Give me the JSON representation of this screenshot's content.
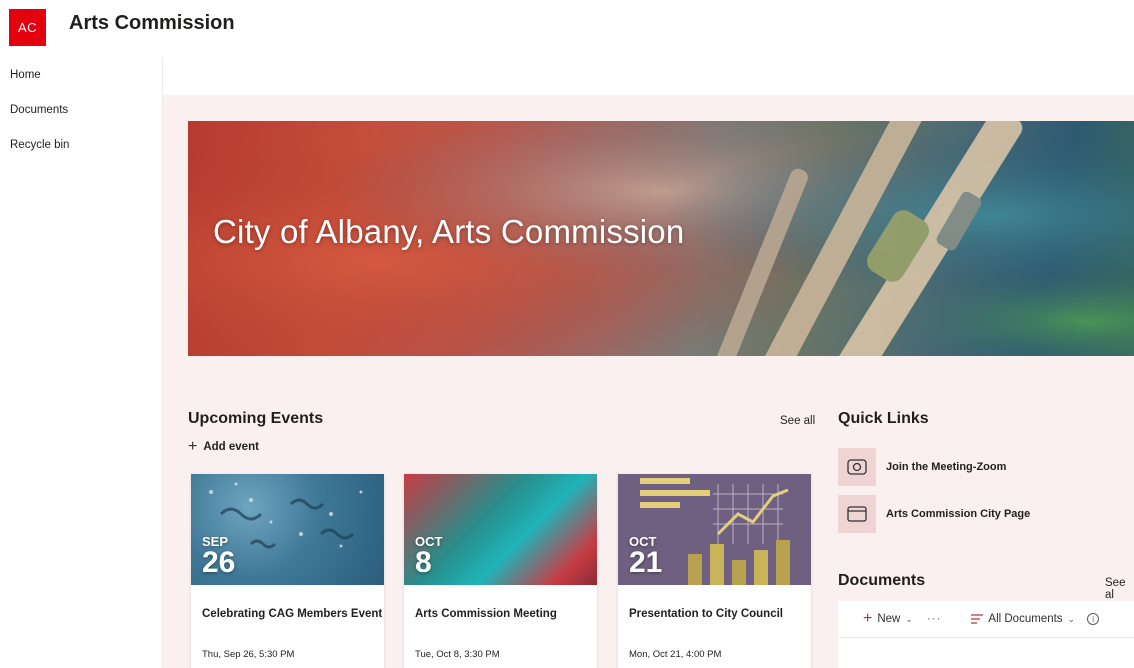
{
  "site": {
    "logo_text": "AC",
    "title": "Arts Commission",
    "brand_color": "#e3000f"
  },
  "nav": {
    "items": [
      {
        "label": "Home"
      },
      {
        "label": "Documents"
      },
      {
        "label": "Recycle bin"
      }
    ]
  },
  "hero": {
    "title": "City of Albany, Arts Commission"
  },
  "events": {
    "title": "Upcoming Events",
    "see_all": "See all",
    "add_label": "Add event",
    "items": [
      {
        "month": "SEP",
        "day": "26",
        "name": "Celebrating CAG Members Event",
        "time": "Thu, Sep 26, 5:30 PM"
      },
      {
        "month": "OCT",
        "day": "8",
        "name": "Arts Commission Meeting",
        "time": "Tue, Oct 8, 3:30 PM"
      },
      {
        "month": "OCT",
        "day": "21",
        "name": "Presentation to City Council",
        "time": "Mon, Oct 21, 4:00 PM"
      }
    ]
  },
  "quick_links": {
    "title": "Quick Links",
    "items": [
      {
        "label": "Join the Meeting-Zoom",
        "icon": "video-icon"
      },
      {
        "label": "Arts Commission City Page",
        "icon": "window-icon"
      }
    ]
  },
  "documents": {
    "title": "Documents",
    "see_all": "See al",
    "new_label": "New",
    "more_label": "···",
    "view_label": "All Documents"
  }
}
